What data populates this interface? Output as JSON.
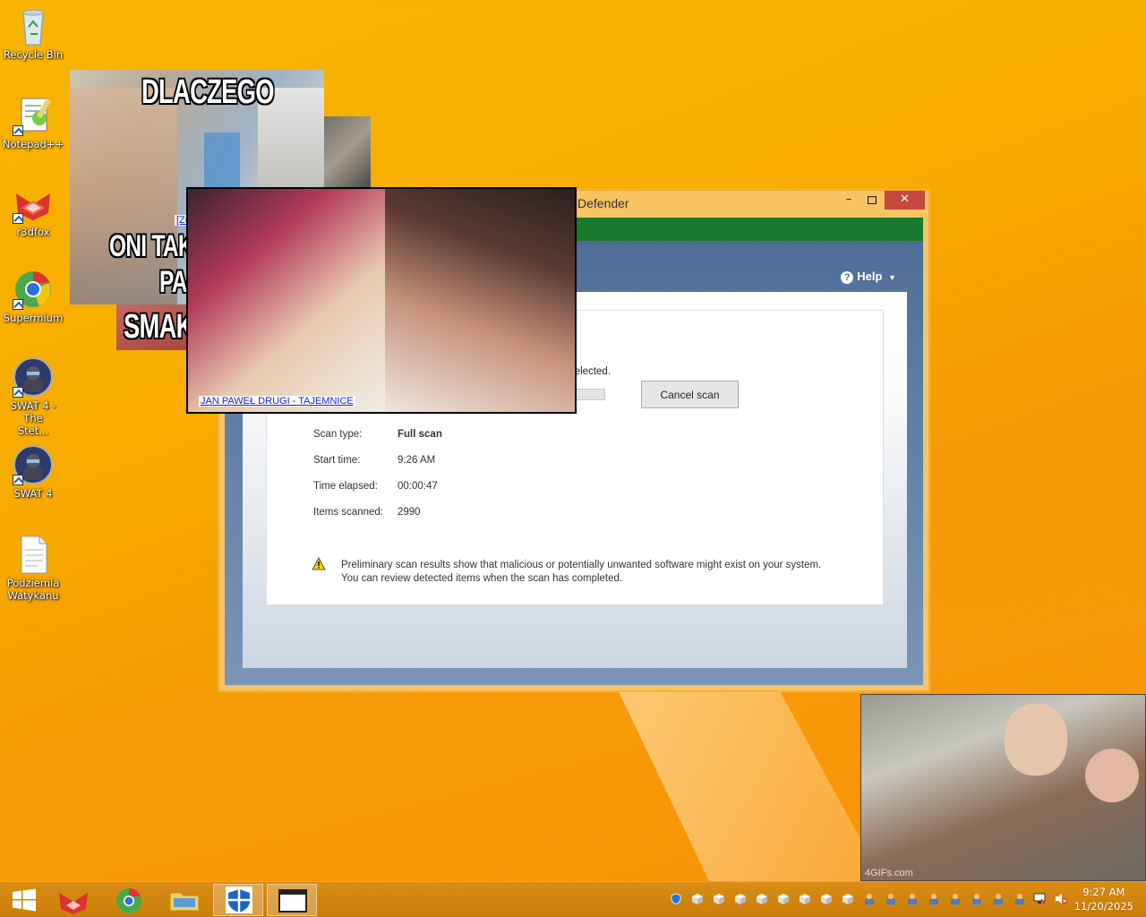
{
  "desktop": {
    "icons": [
      {
        "label": "Recycle Bin",
        "icon": "recycle-bin-icon"
      },
      {
        "label": "Notepad++",
        "icon": "notepadpp-icon"
      },
      {
        "label": "r3dfox",
        "icon": "r3dfox-icon"
      },
      {
        "label": "Supermium",
        "icon": "supermium-icon"
      },
      {
        "label": "SWAT 4 - The Stet...",
        "icon": "swat4-icon"
      },
      {
        "label": "SWAT 4",
        "icon": "swat4-icon"
      },
      {
        "label": "Podziemia Watykanu",
        "icon": "text-document-icon"
      }
    ]
  },
  "defender": {
    "title": "Defender",
    "help_label": "Help",
    "scan_status_text": "an selected.",
    "progress": 0.05,
    "cancel_label": "Cancel scan",
    "details": [
      {
        "label": "Scan type:",
        "value": "Full scan"
      },
      {
        "label": "Start time:",
        "value": "9:26 AM"
      },
      {
        "label": "Time elapsed:",
        "value": "00:00:47"
      },
      {
        "label": "Items scanned:",
        "value": "2990"
      }
    ],
    "warning_line1": "Preliminary scan results show that malicious or potentially unwanted software might exist on your system.",
    "warning_line2": "You can review detected items when the scan has completed.",
    "colors": {
      "header_green": "#197a2d",
      "close_red": "#c7483f",
      "body_blue": "#4e6d97"
    }
  },
  "popups": {
    "classroom": {
      "caption_top": "DLACZEGO",
      "caption_mid": "ONI TAK OBRAŻAJĄ",
      "caption_bottom": "PAPIEŻA",
      "link": "[ZOBACZ]"
    },
    "smakow": {
      "caption": "SMAKO"
    },
    "jp2": {
      "link": "JAN PAWEŁ DRUGI - TAJEMNICE"
    },
    "gif": {
      "watermark": "4GIFs.com"
    }
  },
  "taskbar": {
    "items": [
      "start-button",
      "r3dfox-taskbar",
      "supermium-taskbar",
      "file-explorer-taskbar",
      "defender-taskbar",
      "window-taskbar"
    ],
    "clock_time": "9:27 AM",
    "clock_date": "11/20/2025"
  }
}
